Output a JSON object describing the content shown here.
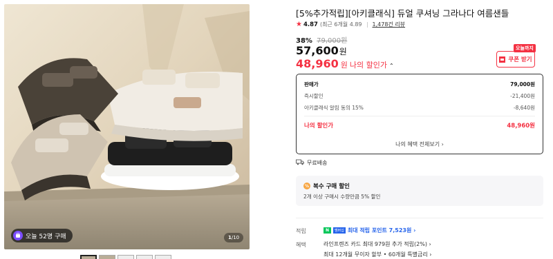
{
  "gallery": {
    "buy_badge": "오늘 52명 구매",
    "counter_current": "1",
    "counter_total": "/10",
    "thumbnails": 5
  },
  "product": {
    "title": "[5%추가적립][아키클래식] 듀얼 쿠셔닝 그라나다 여름샌들",
    "rating": "4.87",
    "rating_detail": "(최근 6개월 4.89",
    "reviews": "1,478건 리뷰",
    "discount_rate": "38%",
    "original_price": "79,000원",
    "sale_price": "57,600",
    "won": "원",
    "my_price": "48,960",
    "my_price_label": "나의 할인가",
    "coupon_tag": "오늘까지",
    "coupon_button": "쿠폰 받기"
  },
  "price_breakdown": {
    "rows": [
      {
        "label": "판매가",
        "value": "79,000원"
      },
      {
        "label": "즉시할인",
        "value": "-21,400원"
      },
      {
        "label": "아키클래식 알림 동의 15%",
        "value": "-8,640원"
      },
      {
        "label": "나의 할인가",
        "value": "48,960원"
      }
    ],
    "view_all": "나의 혜택 전체보기 ›"
  },
  "shipping": {
    "label": "무료배송"
  },
  "multi_buy": {
    "title": "복수 구매 할인",
    "icon_text": "%",
    "desc": "2개 이상 구매시 수량만큼 5% 할인"
  },
  "points": {
    "label": "적립",
    "npay": "N",
    "membership": "멤버십",
    "text": "최대 적립 포인트 7,523원 ›"
  },
  "benefits": {
    "label": "혜택",
    "items": [
      "라인프렌즈 카드 최대 979원 추가 적립(2%) ›",
      "최대 12개월 무이자 할부 • 60개월 특별금리 ›"
    ]
  },
  "colors": {
    "accent": "#f43142",
    "link": "#2563eb"
  },
  "icons": [
    "star-icon",
    "truck-icon",
    "coupon-icon",
    "chevron-up-icon",
    "percent-icon",
    "npay-icon"
  ]
}
